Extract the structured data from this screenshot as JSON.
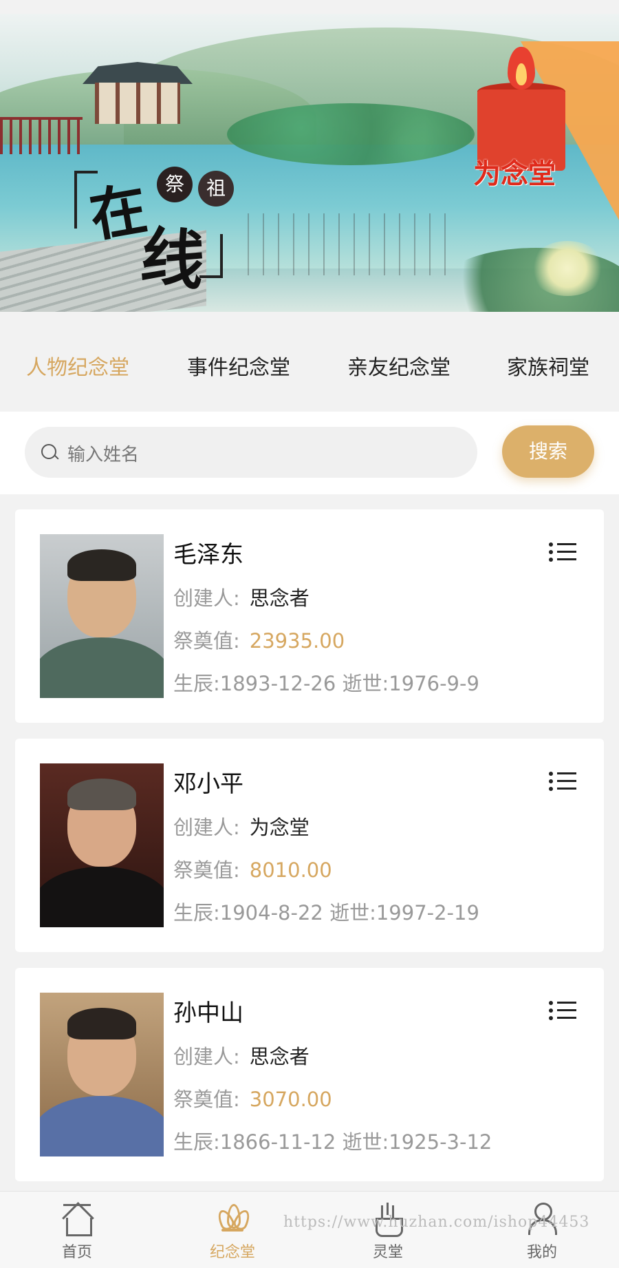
{
  "banner": {
    "title_small": [
      "祭",
      "祖"
    ],
    "title_large": [
      "在",
      "线"
    ],
    "brand": "为念堂"
  },
  "tabs": [
    {
      "label": "人物纪念堂",
      "active": true
    },
    {
      "label": "事件纪念堂",
      "active": false
    },
    {
      "label": "亲友纪念堂",
      "active": false
    },
    {
      "label": "家族祠堂",
      "active": false
    }
  ],
  "search": {
    "placeholder": "输入姓名",
    "button_label": "搜索",
    "icon": "search-icon"
  },
  "labels": {
    "creator": "创建人:",
    "offering": "祭奠值:"
  },
  "memorials": [
    {
      "name": "毛泽东",
      "creator": "思念者",
      "offering_value": "23935.00",
      "dates": "生辰:1893-12-26 逝世:1976-9-9"
    },
    {
      "name": "邓小平",
      "creator": "为念堂",
      "offering_value": "8010.00",
      "dates": "生辰:1904-8-22 逝世:1997-2-19"
    },
    {
      "name": "孙中山",
      "creator": "思念者",
      "offering_value": "3070.00",
      "dates": "生辰:1866-11-12 逝世:1925-3-12"
    }
  ],
  "nav": [
    {
      "label": "首页",
      "icon": "home-icon",
      "active": false
    },
    {
      "label": "纪念堂",
      "icon": "lotus-icon",
      "active": true
    },
    {
      "label": "灵堂",
      "icon": "incense-icon",
      "active": false
    },
    {
      "label": "我的",
      "icon": "user-icon",
      "active": false
    }
  ],
  "watermark": "https://www.huzhan.com/ishop44453",
  "colors": {
    "accent": "#d6a760",
    "button": "#dcb06a",
    "brand_red": "#e02a1b"
  }
}
